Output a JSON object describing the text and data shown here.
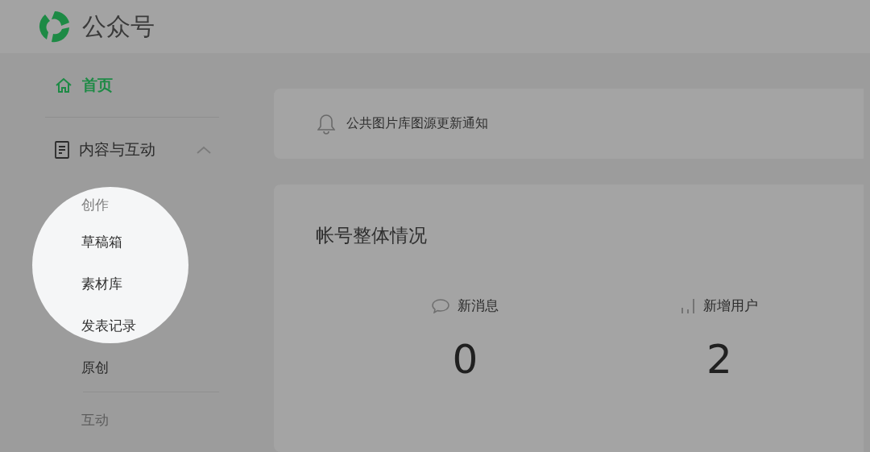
{
  "header": {
    "title": "公众号"
  },
  "sidebar": {
    "items": [
      {
        "kind": "link",
        "label": "首页",
        "selected": true
      },
      {
        "kind": "section",
        "label": "内容与互动",
        "expanded": true,
        "groups": [
          {
            "label": "创作",
            "highlighted": true,
            "items": [
              {
                "label": "草稿箱",
                "highlighted": true
              },
              {
                "label": "素材库",
                "highlighted": true
              },
              {
                "label": "发表记录",
                "highlighted": true
              },
              {
                "label": "原创",
                "highlighted": false
              }
            ]
          },
          {
            "label": "互动",
            "highlighted": false
          }
        ]
      }
    ]
  },
  "notice": {
    "text": "公共图片库图源更新通知"
  },
  "overview": {
    "title": "帐号整体情况",
    "stats": [
      {
        "label": "新消息",
        "value": "0"
      },
      {
        "label": "新增用户",
        "value": "2"
      }
    ]
  }
}
